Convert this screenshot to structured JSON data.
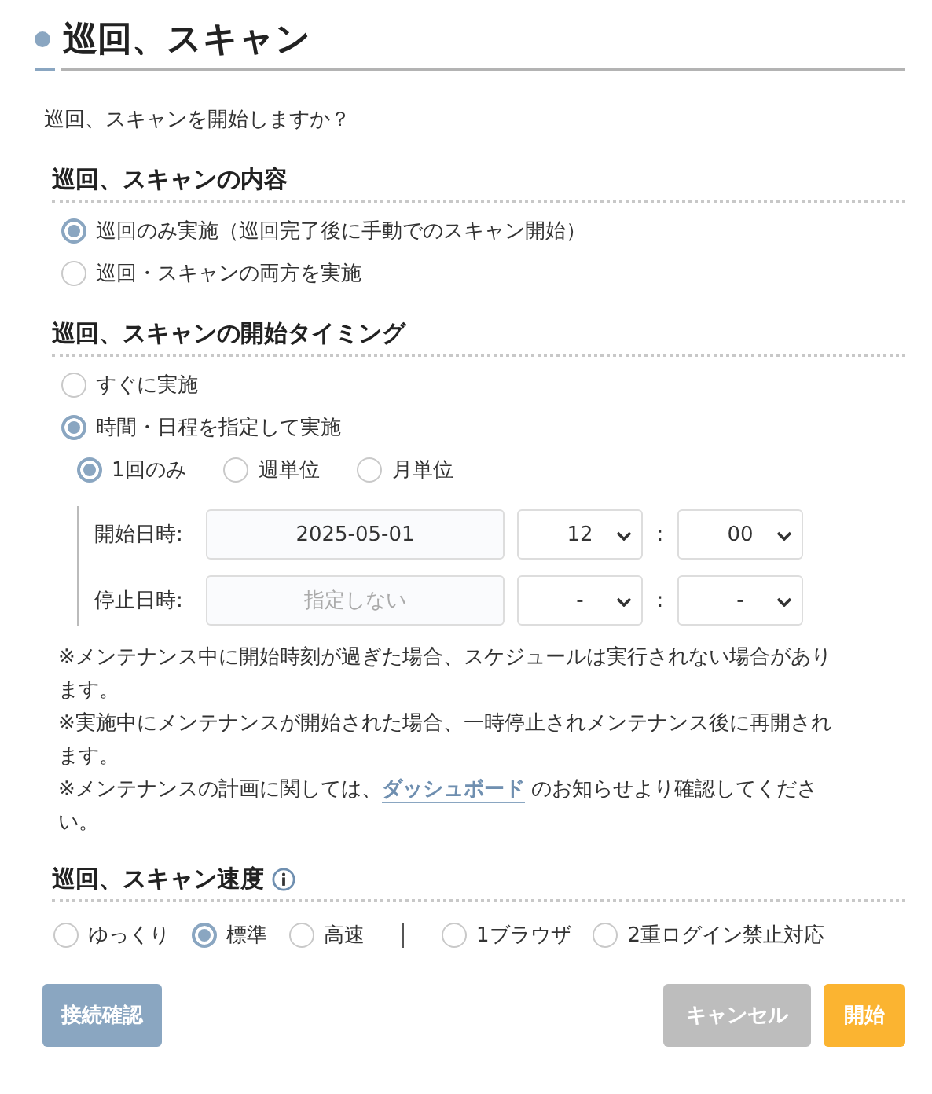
{
  "title": "巡回、スキャン",
  "prompt": "巡回、スキャンを開始しますか？",
  "content": {
    "heading": "巡回、スキャンの内容",
    "options": [
      {
        "label": "巡回のみ実施（巡回完了後に手動でのスキャン開始）",
        "selected": true
      },
      {
        "label": "巡回・スキャンの両方を実施",
        "selected": false
      }
    ]
  },
  "timing": {
    "heading": "巡回、スキャンの開始タイミング",
    "options": [
      {
        "label": "すぐに実施",
        "selected": false
      },
      {
        "label": "時間・日程を指定して実施",
        "selected": true
      }
    ],
    "frequency": [
      {
        "label": "1回のみ",
        "selected": true
      },
      {
        "label": "週単位",
        "selected": false
      },
      {
        "label": "月単位",
        "selected": false
      }
    ],
    "rows": [
      {
        "label": "開始日時:",
        "date": {
          "value": "2025-05-01"
        },
        "hour": "12",
        "minute": "00"
      },
      {
        "label": "停止日時:",
        "date": {
          "placeholder": "指定しない"
        },
        "hour": "-",
        "minute": "-"
      }
    ],
    "separator": ":",
    "notes": [
      {
        "text": "※メンテナンス中に開始時刻が過ぎた場合、スケジュールは実行されない場合があります。"
      },
      {
        "text": "※実施中にメンテナンスが開始された場合、一時停止されメンテナンス後に再開されます。"
      },
      {
        "before": "※メンテナンスの計画に関しては、",
        "link": "ダッシュボード",
        "after": " のお知らせより確認してください。"
      }
    ]
  },
  "speed": {
    "heading": "巡回、スキャン速度",
    "groups": [
      [
        {
          "label": "ゆっくり",
          "selected": false
        },
        {
          "label": "標準",
          "selected": true
        },
        {
          "label": "高速",
          "selected": false
        }
      ],
      [
        {
          "label": "1ブラウザ",
          "selected": false
        },
        {
          "label": "2重ログイン禁止対応",
          "selected": false
        }
      ]
    ]
  },
  "buttons": {
    "check": "接続確認",
    "cancel": "キャンセル",
    "start": "開始"
  }
}
